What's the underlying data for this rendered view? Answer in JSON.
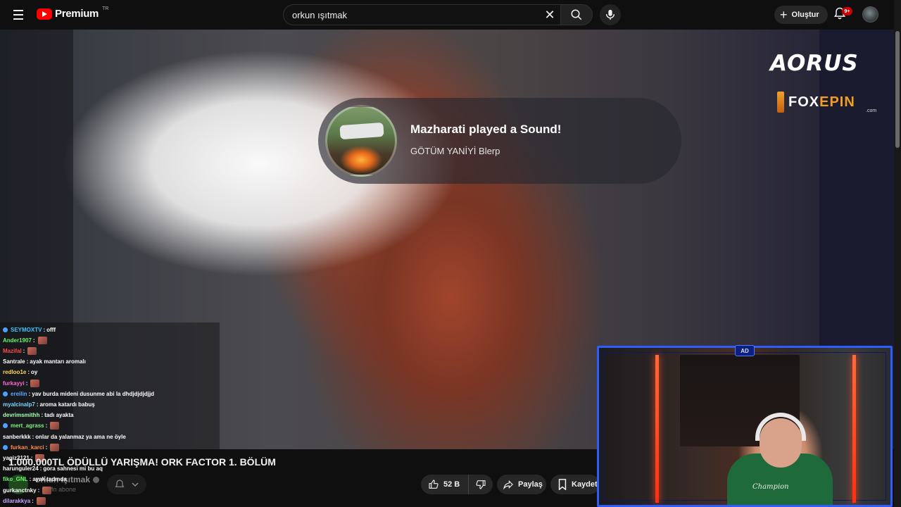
{
  "header": {
    "logo_text": "Premium",
    "region": "TR",
    "search_value": "orkun ışıtmak",
    "create_label": "Oluştur",
    "notifications_badge": "9+"
  },
  "overlay": {
    "alert_title": "Mazharati played a Sound!",
    "alert_subtitle": "GÖTÜM YANİYİ Blerp",
    "sponsor_aorus": "AORUS",
    "sponsor_fox_main": "FOX",
    "sponsor_fox_accent": "EPIN",
    "sponsor_fox_domain": ".com",
    "cam_logo": "AD",
    "cam_shirt": "Champion"
  },
  "chat": [
    {
      "user": "SEYMOXTV",
      "color": "#39c6ff",
      "message": "offf",
      "badge": true,
      "emote": false
    },
    {
      "user": "Ander1907",
      "color": "#6cf56c",
      "message": "",
      "badge": false,
      "emote": true
    },
    {
      "user": "Mazifal",
      "color": "#ff4a4a",
      "message": "",
      "badge": false,
      "emote": true
    },
    {
      "user": "Santrale",
      "color": "#ffffff",
      "message": "ayak mantarı aromalı",
      "badge": false,
      "emote": false
    },
    {
      "user": "redloo1e",
      "color": "#ffd84a",
      "message": "oy",
      "badge": false,
      "emote": false
    },
    {
      "user": "furkayyi",
      "color": "#ff6ad5",
      "message": "",
      "badge": false,
      "emote": true
    },
    {
      "user": "ereilin",
      "color": "#5aa9ff",
      "message": "yav burda mideni dusunme abi la dhdjdjdjdjjd",
      "badge": true,
      "emote": false
    },
    {
      "user": "myalcinalp7",
      "color": "#7ad7ff",
      "message": "aroma katardı babuş",
      "badge": false,
      "emote": false
    },
    {
      "user": "devrimsmithh",
      "color": "#a6ffb0",
      "message": "tadı ayakta",
      "badge": false,
      "emote": false
    },
    {
      "user": "mert_agrass",
      "color": "#7cf27c",
      "message": "",
      "badge": true,
      "emote": true
    },
    {
      "user": "sanberkkk",
      "color": "#ffffff",
      "message": "onlar da yalanmaz ya ama ne öyle",
      "badge": false,
      "emote": false
    },
    {
      "user": "furkan_karci",
      "color": "#ff8a4a",
      "message": "",
      "badge": true,
      "emote": true
    },
    {
      "user": "yagiz2121",
      "color": "#ffffff",
      "message": "",
      "badge": false,
      "emote": true
    },
    {
      "user": "harunguler24",
      "color": "#ffffff",
      "message": "gora sahnesi mi bu aq",
      "badge": false,
      "emote": false
    },
    {
      "user": "fiko_GNL",
      "color": "#6cf56c",
      "message": "ayak tadında",
      "badge": false,
      "emote": false
    },
    {
      "user": "gurkanctnky",
      "color": "#ffffff",
      "message": "",
      "badge": false,
      "emote": true
    },
    {
      "user": "dilarakkya",
      "color": "#c9a6ff",
      "message": "",
      "badge": false,
      "emote": true
    }
  ],
  "video": {
    "title": "1.000.000TL ÖDÜLLÜ YARIŞMA! ORK FACTOR 1. BÖLÜM",
    "channel": "orkun ışıtmak",
    "subscribers": "Mn abone",
    "likes": "52 B",
    "share_label": "Paylaş",
    "save_label": "Kaydet"
  },
  "colors": {
    "accent_red": "#ff0000",
    "cam_border": "#2f5cff",
    "fox_accent": "#f39c1f"
  }
}
